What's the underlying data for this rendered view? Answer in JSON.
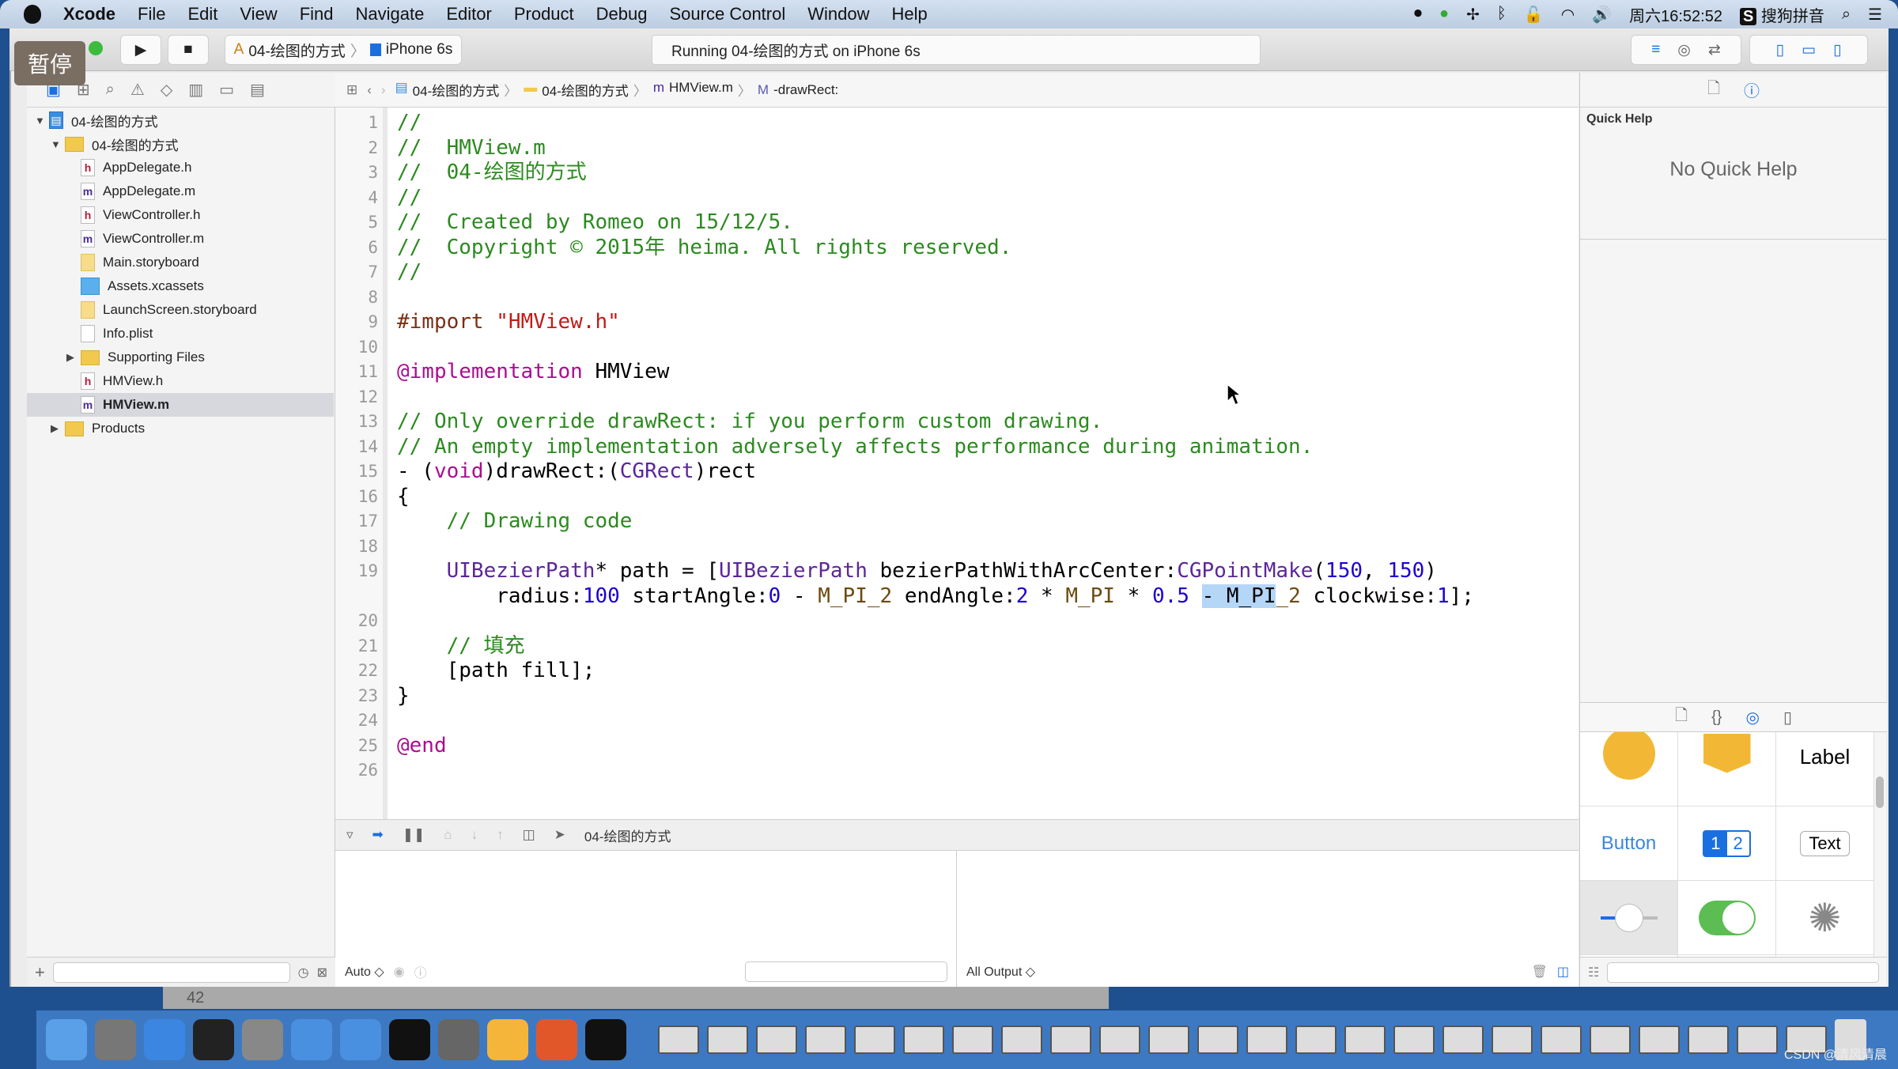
{
  "menubar": {
    "app": "Xcode",
    "items": [
      "File",
      "Edit",
      "View",
      "Find",
      "Navigate",
      "Editor",
      "Product",
      "Debug",
      "Source Control",
      "Window",
      "Help"
    ],
    "clock": "周六16:52:52",
    "input_method": "搜狗拼音",
    "status_icons": [
      "screen-record-icon",
      "green-app-icon",
      "fan-icon",
      "bluetooth-icon",
      "lock-icon",
      "wifi-icon",
      "volume-icon"
    ]
  },
  "overlay": {
    "pause_label": "暂停"
  },
  "toolbar": {
    "scheme": "04-绘图的方式",
    "device": "iPhone 6s",
    "activity": "Running 04-绘图的方式 on iPhone 6s"
  },
  "jumpbar": {
    "crumbs": [
      "04-绘图的方式",
      "04-绘图的方式",
      "HMView.m",
      "-drawRect:"
    ]
  },
  "navigator": {
    "items": [
      {
        "label": "04-绘图的方式",
        "type": "proj",
        "depth": 0,
        "disclosure": "open"
      },
      {
        "label": "04-绘图的方式",
        "type": "folder",
        "depth": 1,
        "disclosure": "open"
      },
      {
        "label": "AppDelegate.h",
        "type": "h",
        "depth": 2
      },
      {
        "label": "AppDelegate.m",
        "type": "m",
        "depth": 2
      },
      {
        "label": "ViewController.h",
        "type": "h",
        "depth": 2
      },
      {
        "label": "ViewController.m",
        "type": "m",
        "depth": 2
      },
      {
        "label": "Main.storyboard",
        "type": "sb",
        "depth": 2
      },
      {
        "label": "Assets.xcassets",
        "type": "assets",
        "depth": 2
      },
      {
        "label": "LaunchScreen.storyboard",
        "type": "sb",
        "depth": 2
      },
      {
        "label": "Info.plist",
        "type": "plist",
        "depth": 2
      },
      {
        "label": "Supporting Files",
        "type": "folder",
        "depth": 2,
        "disclosure": "closed"
      },
      {
        "label": "HMView.h",
        "type": "h",
        "depth": 2
      },
      {
        "label": "HMView.m",
        "type": "m",
        "depth": 2,
        "selected": true
      },
      {
        "label": "Products",
        "type": "folder",
        "depth": 1,
        "disclosure": "closed"
      }
    ]
  },
  "editor": {
    "lines": [
      {
        "n": "1",
        "tokens": [
          [
            "//",
            "comment"
          ]
        ]
      },
      {
        "n": "2",
        "tokens": [
          [
            "//  HMView.m",
            "comment"
          ]
        ]
      },
      {
        "n": "3",
        "tokens": [
          [
            "//  04-绘图的方式",
            "comment"
          ]
        ]
      },
      {
        "n": "4",
        "tokens": [
          [
            "//",
            "comment"
          ]
        ]
      },
      {
        "n": "5",
        "tokens": [
          [
            "//  Created by Romeo on 15/12/5.",
            "comment"
          ]
        ]
      },
      {
        "n": "6",
        "tokens": [
          [
            "//  Copyright © 2015年 heima. All rights reserved.",
            "comment"
          ]
        ]
      },
      {
        "n": "7",
        "tokens": [
          [
            "//",
            "comment"
          ]
        ]
      },
      {
        "n": "8",
        "tokens": []
      },
      {
        "n": "9",
        "tokens": [
          [
            "#import ",
            "preproc"
          ],
          [
            "\"HMView.h\"",
            "string"
          ]
        ]
      },
      {
        "n": "10",
        "tokens": []
      },
      {
        "n": "11",
        "tokens": [
          [
            "@implementation",
            "keyword"
          ],
          [
            " HMView",
            "plain"
          ]
        ]
      },
      {
        "n": "12",
        "tokens": []
      },
      {
        "n": "13",
        "tokens": [
          [
            "// Only override drawRect: if you perform custom drawing.",
            "comment"
          ]
        ]
      },
      {
        "n": "14",
        "tokens": [
          [
            "// An empty implementation adversely affects performance during animation.",
            "comment"
          ]
        ]
      },
      {
        "n": "15",
        "tokens": [
          [
            "- (",
            "plain"
          ],
          [
            "void",
            "keyword"
          ],
          [
            ")drawRect:(",
            "plain"
          ],
          [
            "CGRect",
            "class"
          ],
          [
            ")rect",
            "plain"
          ]
        ]
      },
      {
        "n": "16",
        "tokens": [
          [
            "{",
            "plain"
          ]
        ]
      },
      {
        "n": "17",
        "tokens": [
          [
            "    ",
            "plain"
          ],
          [
            "// Drawing code",
            "comment"
          ]
        ]
      },
      {
        "n": "18",
        "tokens": []
      },
      {
        "n": "19",
        "tokens": [
          [
            "    ",
            "plain"
          ],
          [
            "UIBezierPath",
            "class"
          ],
          [
            "* path = [",
            "plain"
          ],
          [
            "UIBezierPath",
            "class"
          ],
          [
            " bezierPathWithArcCenter:",
            "plain"
          ],
          [
            "CGPointMake",
            "class"
          ],
          [
            "(",
            "plain"
          ],
          [
            "150",
            "number"
          ],
          [
            ", ",
            "plain"
          ],
          [
            "150",
            "number"
          ],
          [
            ")",
            "plain"
          ]
        ]
      },
      {
        "n": "",
        "tokens": [
          [
            "        radius:",
            "plain"
          ],
          [
            "100",
            "number"
          ],
          [
            " startAngle:",
            "plain"
          ],
          [
            "0",
            "number"
          ],
          [
            " - ",
            "plain"
          ],
          [
            "M_PI_2",
            "macro"
          ],
          [
            " endAngle:",
            "plain"
          ],
          [
            "2",
            "number"
          ],
          [
            " * ",
            "plain"
          ],
          [
            "M_PI",
            "macro"
          ],
          [
            " * ",
            "plain"
          ],
          [
            "0.5",
            "number"
          ],
          [
            " ",
            "plain"
          ],
          [
            "- M_PI",
            "sel"
          ],
          [
            "_2",
            "macro"
          ],
          [
            " clockwise:",
            "plain"
          ],
          [
            "1",
            "number"
          ],
          [
            "];",
            "plain"
          ]
        ]
      },
      {
        "n": "20",
        "tokens": []
      },
      {
        "n": "21",
        "tokens": [
          [
            "    ",
            "plain"
          ],
          [
            "// 填充",
            "comment"
          ]
        ]
      },
      {
        "n": "22",
        "tokens": [
          [
            "    [path fill];",
            "plain"
          ]
        ]
      },
      {
        "n": "23",
        "tokens": [
          [
            "}",
            "plain"
          ]
        ]
      },
      {
        "n": "24",
        "tokens": []
      },
      {
        "n": "25",
        "tokens": [
          [
            "@end",
            "keyword"
          ]
        ]
      },
      {
        "n": "26",
        "tokens": []
      }
    ]
  },
  "debug": {
    "target": "04-绘图的方式",
    "var_scope": "Auto ◇",
    "console_scope": "All Output ◇"
  },
  "inspector": {
    "quick_help_title": "Quick Help",
    "quick_help_empty": "No Quick Help",
    "library": [
      {
        "name": "av-player-object",
        "label": ""
      },
      {
        "name": "object-cube",
        "label": ""
      },
      {
        "name": "label-object",
        "label": "Label"
      },
      {
        "name": "button-object",
        "label": "Button"
      },
      {
        "name": "segmented-control-object",
        "label": "1|2"
      },
      {
        "name": "text-field-object",
        "label": "Text"
      },
      {
        "name": "slider-object",
        "label": ""
      },
      {
        "name": "switch-object",
        "label": ""
      },
      {
        "name": "activity-indicator-object",
        "label": ""
      },
      {
        "name": "progress-view-object",
        "label": ""
      },
      {
        "name": "view-object",
        "label": ""
      },
      {
        "name": "stepper-object",
        "label": ""
      }
    ]
  },
  "strip": {
    "label": "42"
  },
  "dock": {
    "apps": [
      "finder",
      "launchpad",
      "safari",
      "mouse-app",
      "photo-slideshow",
      "xcode",
      "simulator",
      "terminal",
      "system-preferences",
      "sketch",
      "powerpoint",
      "console"
    ],
    "window_thumbs": 24
  },
  "watermark": "CSDN @清风清晨",
  "colors": {
    "accent": "#1a6fe0",
    "comment": "#2c8a20",
    "keyword": "#aa0d91",
    "number": "#1c00cf",
    "switch_on": "#5cbd52"
  }
}
